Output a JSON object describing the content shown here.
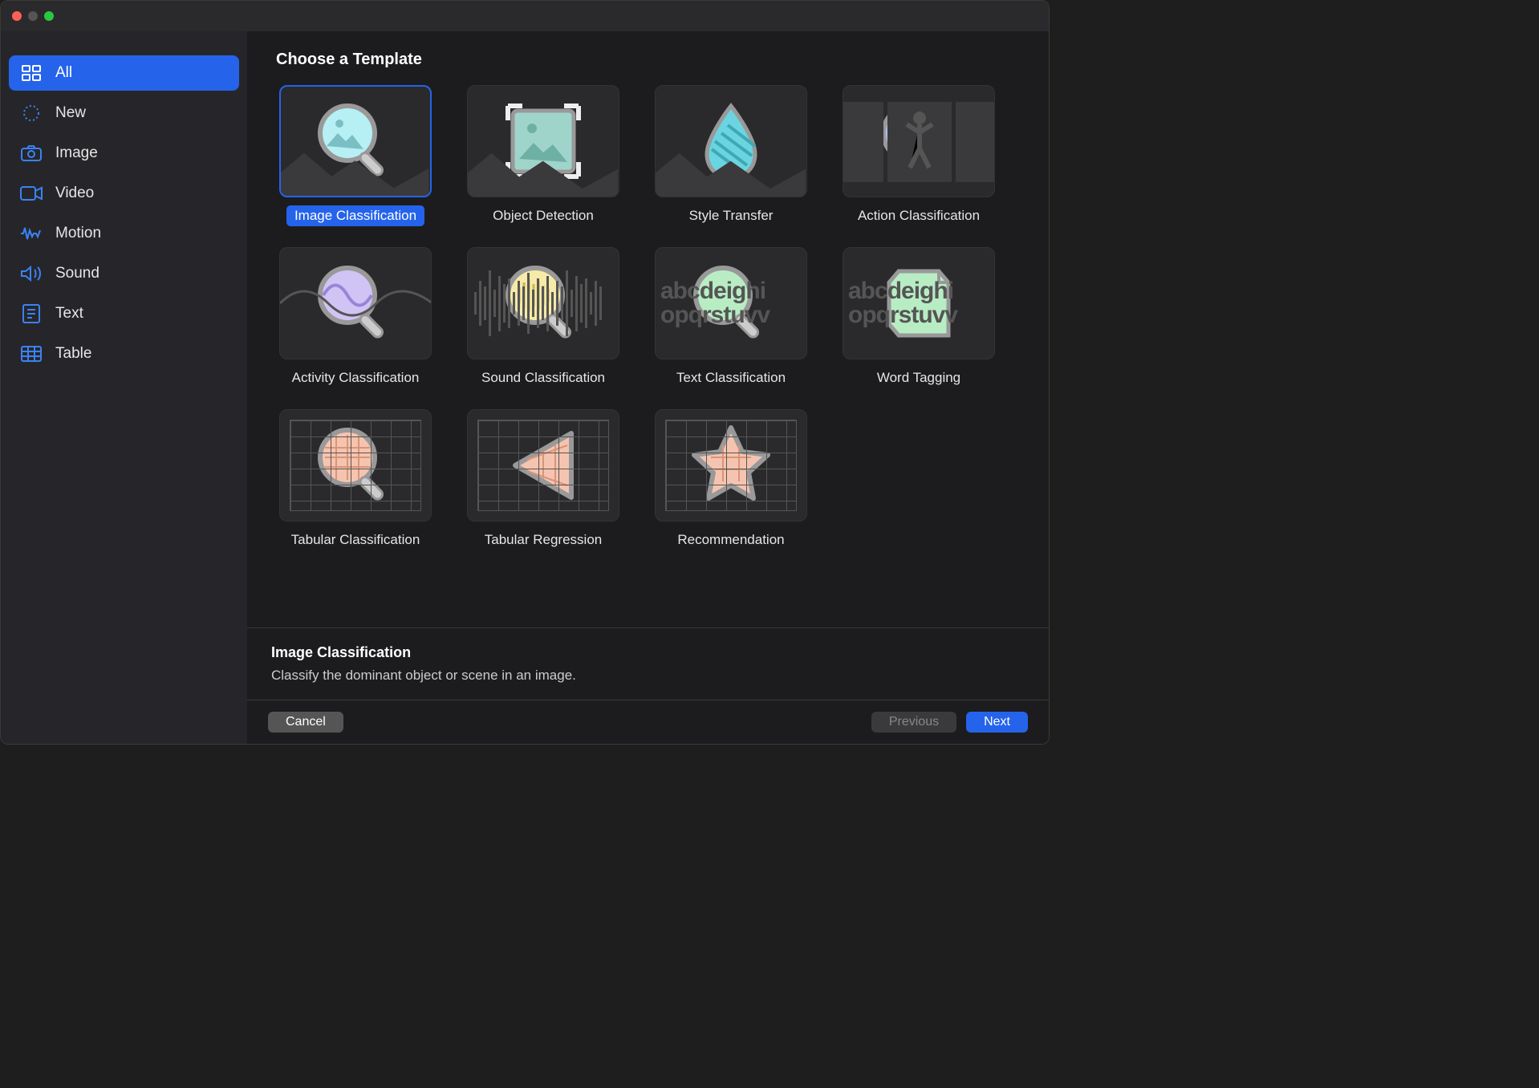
{
  "heading": "Choose a Template",
  "sidebar": [
    {
      "label": "All",
      "icon": "grid"
    },
    {
      "label": "New",
      "icon": "sparkle"
    },
    {
      "label": "Image",
      "icon": "camera"
    },
    {
      "label": "Video",
      "icon": "video"
    },
    {
      "label": "Motion",
      "icon": "motion"
    },
    {
      "label": "Sound",
      "icon": "sound"
    },
    {
      "label": "Text",
      "icon": "text"
    },
    {
      "label": "Table",
      "icon": "table"
    }
  ],
  "selectedSidebar": 0,
  "templates": [
    {
      "label": "Image Classification"
    },
    {
      "label": "Object Detection"
    },
    {
      "label": "Style Transfer"
    },
    {
      "label": "Action Classification"
    },
    {
      "label": "Activity Classification"
    },
    {
      "label": "Sound Classification"
    },
    {
      "label": "Text Classification"
    },
    {
      "label": "Word Tagging"
    },
    {
      "label": "Tabular Classification"
    },
    {
      "label": "Tabular Regression"
    },
    {
      "label": "Recommendation"
    }
  ],
  "selectedTemplate": 0,
  "detail": {
    "title": "Image Classification",
    "description": "Classify the dominant object or scene in an image."
  },
  "footer": {
    "cancel": "Cancel",
    "previous": "Previous",
    "next": "Next"
  }
}
